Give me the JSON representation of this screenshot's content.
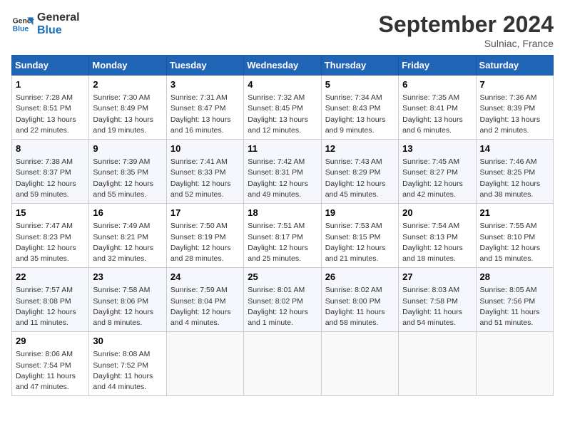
{
  "logo": {
    "line1": "General",
    "line2": "Blue"
  },
  "title": "September 2024",
  "location": "Sulniac, France",
  "days_of_week": [
    "Sunday",
    "Monday",
    "Tuesday",
    "Wednesday",
    "Thursday",
    "Friday",
    "Saturday"
  ],
  "weeks": [
    [
      {
        "day": "1",
        "info": "Sunrise: 7:28 AM\nSunset: 8:51 PM\nDaylight: 13 hours\nand 22 minutes."
      },
      {
        "day": "2",
        "info": "Sunrise: 7:30 AM\nSunset: 8:49 PM\nDaylight: 13 hours\nand 19 minutes."
      },
      {
        "day": "3",
        "info": "Sunrise: 7:31 AM\nSunset: 8:47 PM\nDaylight: 13 hours\nand 16 minutes."
      },
      {
        "day": "4",
        "info": "Sunrise: 7:32 AM\nSunset: 8:45 PM\nDaylight: 13 hours\nand 12 minutes."
      },
      {
        "day": "5",
        "info": "Sunrise: 7:34 AM\nSunset: 8:43 PM\nDaylight: 13 hours\nand 9 minutes."
      },
      {
        "day": "6",
        "info": "Sunrise: 7:35 AM\nSunset: 8:41 PM\nDaylight: 13 hours\nand 6 minutes."
      },
      {
        "day": "7",
        "info": "Sunrise: 7:36 AM\nSunset: 8:39 PM\nDaylight: 13 hours\nand 2 minutes."
      }
    ],
    [
      {
        "day": "8",
        "info": "Sunrise: 7:38 AM\nSunset: 8:37 PM\nDaylight: 12 hours\nand 59 minutes."
      },
      {
        "day": "9",
        "info": "Sunrise: 7:39 AM\nSunset: 8:35 PM\nDaylight: 12 hours\nand 55 minutes."
      },
      {
        "day": "10",
        "info": "Sunrise: 7:41 AM\nSunset: 8:33 PM\nDaylight: 12 hours\nand 52 minutes."
      },
      {
        "day": "11",
        "info": "Sunrise: 7:42 AM\nSunset: 8:31 PM\nDaylight: 12 hours\nand 49 minutes."
      },
      {
        "day": "12",
        "info": "Sunrise: 7:43 AM\nSunset: 8:29 PM\nDaylight: 12 hours\nand 45 minutes."
      },
      {
        "day": "13",
        "info": "Sunrise: 7:45 AM\nSunset: 8:27 PM\nDaylight: 12 hours\nand 42 minutes."
      },
      {
        "day": "14",
        "info": "Sunrise: 7:46 AM\nSunset: 8:25 PM\nDaylight: 12 hours\nand 38 minutes."
      }
    ],
    [
      {
        "day": "15",
        "info": "Sunrise: 7:47 AM\nSunset: 8:23 PM\nDaylight: 12 hours\nand 35 minutes."
      },
      {
        "day": "16",
        "info": "Sunrise: 7:49 AM\nSunset: 8:21 PM\nDaylight: 12 hours\nand 32 minutes."
      },
      {
        "day": "17",
        "info": "Sunrise: 7:50 AM\nSunset: 8:19 PM\nDaylight: 12 hours\nand 28 minutes."
      },
      {
        "day": "18",
        "info": "Sunrise: 7:51 AM\nSunset: 8:17 PM\nDaylight: 12 hours\nand 25 minutes."
      },
      {
        "day": "19",
        "info": "Sunrise: 7:53 AM\nSunset: 8:15 PM\nDaylight: 12 hours\nand 21 minutes."
      },
      {
        "day": "20",
        "info": "Sunrise: 7:54 AM\nSunset: 8:13 PM\nDaylight: 12 hours\nand 18 minutes."
      },
      {
        "day": "21",
        "info": "Sunrise: 7:55 AM\nSunset: 8:10 PM\nDaylight: 12 hours\nand 15 minutes."
      }
    ],
    [
      {
        "day": "22",
        "info": "Sunrise: 7:57 AM\nSunset: 8:08 PM\nDaylight: 12 hours\nand 11 minutes."
      },
      {
        "day": "23",
        "info": "Sunrise: 7:58 AM\nSunset: 8:06 PM\nDaylight: 12 hours\nand 8 minutes."
      },
      {
        "day": "24",
        "info": "Sunrise: 7:59 AM\nSunset: 8:04 PM\nDaylight: 12 hours\nand 4 minutes."
      },
      {
        "day": "25",
        "info": "Sunrise: 8:01 AM\nSunset: 8:02 PM\nDaylight: 12 hours\nand 1 minute."
      },
      {
        "day": "26",
        "info": "Sunrise: 8:02 AM\nSunset: 8:00 PM\nDaylight: 11 hours\nand 58 minutes."
      },
      {
        "day": "27",
        "info": "Sunrise: 8:03 AM\nSunset: 7:58 PM\nDaylight: 11 hours\nand 54 minutes."
      },
      {
        "day": "28",
        "info": "Sunrise: 8:05 AM\nSunset: 7:56 PM\nDaylight: 11 hours\nand 51 minutes."
      }
    ],
    [
      {
        "day": "29",
        "info": "Sunrise: 8:06 AM\nSunset: 7:54 PM\nDaylight: 11 hours\nand 47 minutes."
      },
      {
        "day": "30",
        "info": "Sunrise: 8:08 AM\nSunset: 7:52 PM\nDaylight: 11 hours\nand 44 minutes."
      },
      {
        "day": "",
        "info": ""
      },
      {
        "day": "",
        "info": ""
      },
      {
        "day": "",
        "info": ""
      },
      {
        "day": "",
        "info": ""
      },
      {
        "day": "",
        "info": ""
      }
    ]
  ]
}
